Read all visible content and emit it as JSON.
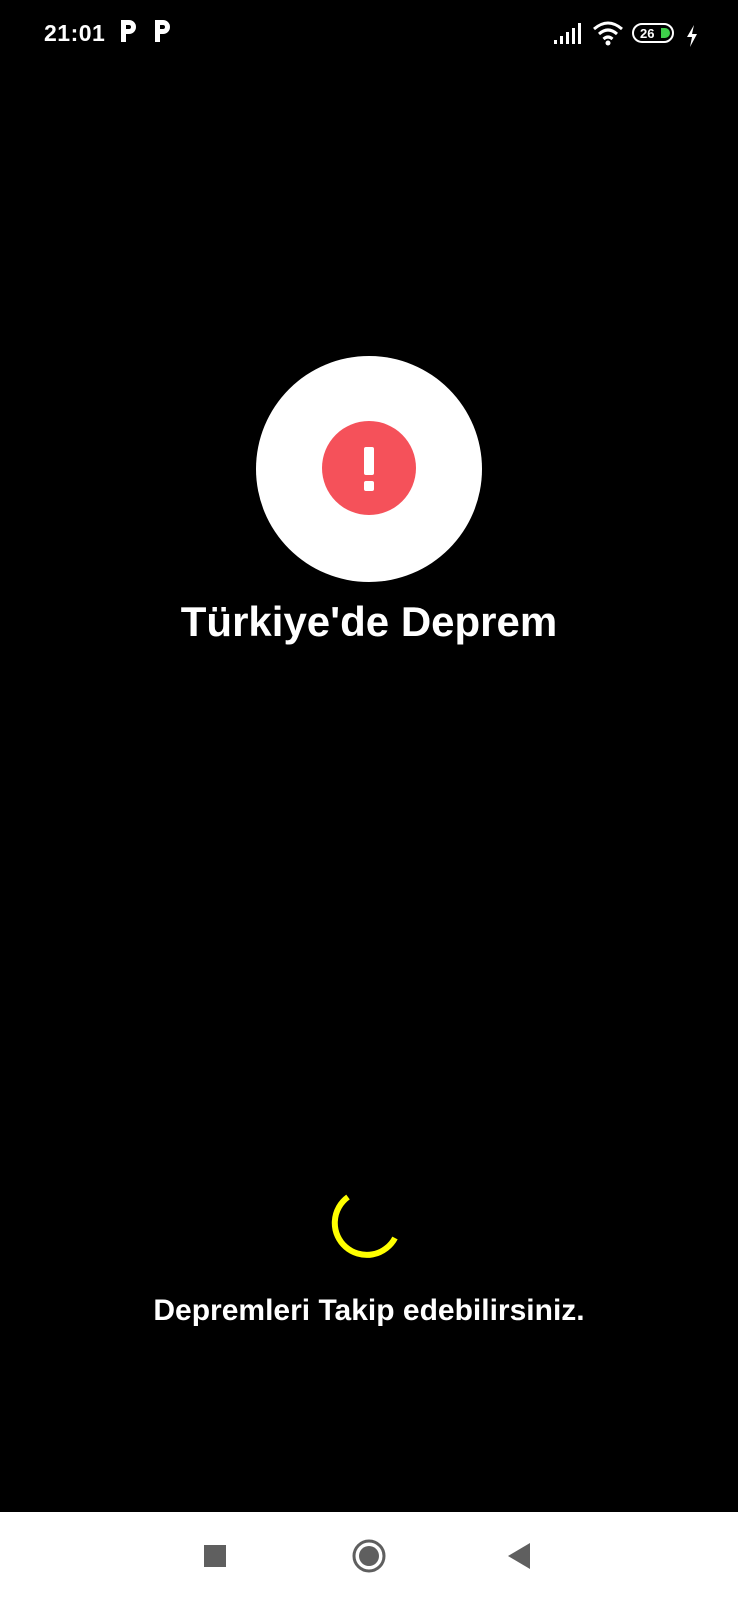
{
  "status_bar": {
    "time": "21:01",
    "notification_icons": [
      "parking-app-icon",
      "parking-app-icon"
    ],
    "signal_icon": "signal-bars-icon",
    "wifi_icon": "wifi-icon",
    "battery_level": "26",
    "charging_icon": "charging-bolt-icon"
  },
  "splash": {
    "logo_icon": "alert-exclamation-icon",
    "title": "Türkiye'de Deprem",
    "loading_text": "Depremleri Takip edebilirsiniz."
  },
  "nav_bar": {
    "recents_icon": "recents-square-icon",
    "home_icon": "home-circle-icon",
    "back_icon": "back-triangle-icon"
  },
  "colors": {
    "background": "#000000",
    "alert_red": "#f5515a",
    "spinner_yellow": "#ffff00",
    "battery_green": "#3ecf4a",
    "nav_bar_bg": "#ffffff",
    "nav_icon": "#5f5f5f"
  }
}
